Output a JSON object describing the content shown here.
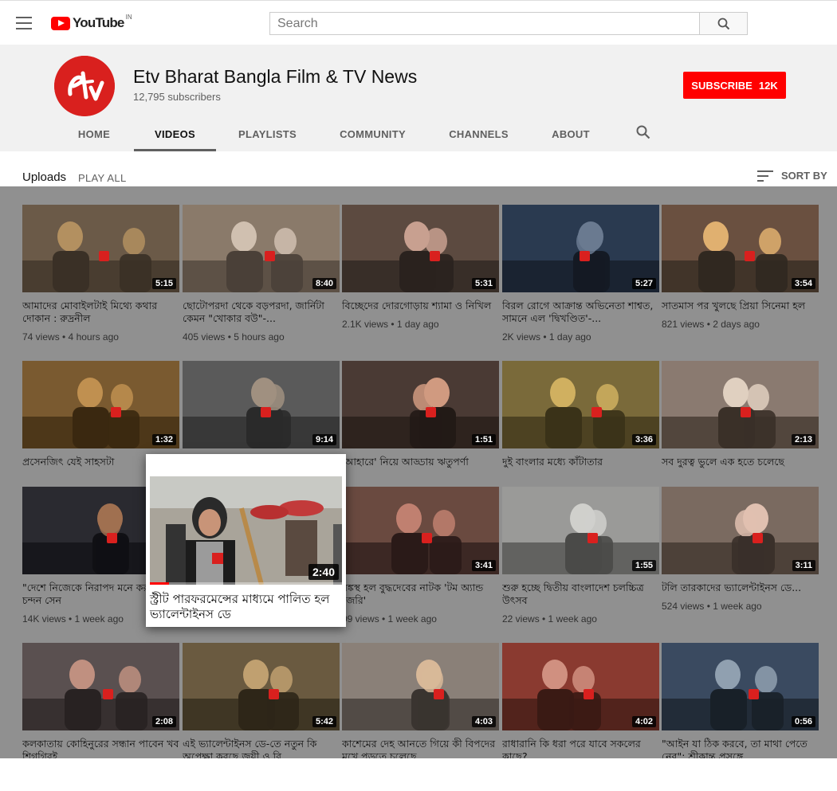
{
  "header": {
    "menu_icon": "hamburger-menu-icon",
    "logo_text": "YouTube",
    "logo_country": "IN",
    "search_placeholder": "Search",
    "search_icon": "search-icon"
  },
  "channel": {
    "name": "Etv Bharat Bangla Film & TV News",
    "subscribers": "12,795 subscribers",
    "avatar_text": "Etv",
    "subscribe_label": "SUBSCRIBE",
    "subscribe_count": "12K",
    "brand_color": "#d9201e"
  },
  "tabs": [
    {
      "label": "HOME",
      "active": false
    },
    {
      "label": "VIDEOS",
      "active": true
    },
    {
      "label": "PLAYLISTS",
      "active": false
    },
    {
      "label": "COMMUNITY",
      "active": false
    },
    {
      "label": "CHANNELS",
      "active": false
    },
    {
      "label": "ABOUT",
      "active": false
    }
  ],
  "uploads": {
    "title": "Uploads",
    "play_all": "PLAY ALL",
    "sort_by": "SORT BY"
  },
  "videos": [
    {
      "title": "আমাদের মোবাইলটাই মিথ্যে কথার দোকান : রুদ্রনীল",
      "meta": "74 views • 4 hours ago",
      "duration": "5:15"
    },
    {
      "title": "ছোটোপরদা থেকে বড়পরদা, জার্নিটা কেমন \"খোকার বউ\"-...",
      "meta": "405 views • 5 hours ago",
      "duration": "8:40"
    },
    {
      "title": "বিচ্ছেদের দোরগোড়ায় শ্যামা ও নিখিল",
      "meta": "2.1K views • 1 day ago",
      "duration": "5:31"
    },
    {
      "title": "বিরল রোগে আক্রান্ত অভিনেতা শাশ্বত, সামনে এল 'দ্বিখণ্ডিত'-...",
      "meta": "2K views • 1 day ago",
      "duration": "5:27"
    },
    {
      "title": "সাতমাস পর খুলছে প্রিয়া সিনেমা হল",
      "meta": "821 views • 2 days ago",
      "duration": "3:54"
    },
    {
      "title": "প্রসেনজিৎ যেই সাহসটা",
      "meta": "",
      "duration": "1:32"
    },
    {
      "title": "",
      "meta": "",
      "duration": "9:14"
    },
    {
      "title": "'আহারে' নিয়ে আড্ডায় ঋতুপর্ণা",
      "meta": "",
      "duration": "1:51"
    },
    {
      "title": "দুই বাংলার মধ্যে কাঁটাতার",
      "meta": "",
      "duration": "3:36"
    },
    {
      "title": "সব দুরত্ব ভুলে এক হতে চলেছে",
      "meta": "",
      "duration": "2:13"
    },
    {
      "title": "\"দেশে নিজেকে নিরাপদ মনে করছি না\": চন্দন সেন",
      "meta": "14K views • 1 week ago",
      "duration": ""
    },
    {
      "title": "",
      "meta": "",
      "duration": ""
    },
    {
      "title": "বঙ্কস্থ হল বুদ্ধদেবের নাটক 'টম অ্যান্ড জেরি'",
      "meta": "09 views • 1 week ago",
      "duration": "3:41"
    },
    {
      "title": "শুরু হচ্ছে দ্বিতীয় বাংলাদেশ চলচ্চিত্র উৎসব",
      "meta": "22 views • 1 week ago",
      "duration": "1:55"
    },
    {
      "title": "টলি তারকাদের ভ্যালেন্টাইনস ডে...",
      "meta": "524 views • 1 week ago",
      "duration": "3:11"
    },
    {
      "title": "কলকাতায় কোহিনুরের সন্ধান পাবেন খব শিগগিরই...",
      "meta": "",
      "duration": "2:08"
    },
    {
      "title": "এই ভ্যালেন্টাইনস ডে-তে নতুন কি অপেক্ষা করছে জয়ী ও রি...",
      "meta": "",
      "duration": "5:42"
    },
    {
      "title": "কাশেমের দেহ আনতে গিয়ে কী বিপদের মুখে পড়তে চলেছে...",
      "meta": "",
      "duration": "4:03"
    },
    {
      "title": "রাধারানি কি ধরা পরে যাবে সকলের কাছে?",
      "meta": "",
      "duration": "4:02"
    },
    {
      "title": "\"আইন যা ঠিক করবে, তা মাথা পেতে নেব\": শ্রীকান্ত প্রসঙ্গে...",
      "meta": "",
      "duration": "0:56"
    }
  ],
  "popup": {
    "title": "স্ট্রীট পারফরমেন্সের মাধ্যমে পালিত হল ভ্যালেন্টাইনস ডে",
    "duration": "2:40",
    "progress": 0.1
  }
}
